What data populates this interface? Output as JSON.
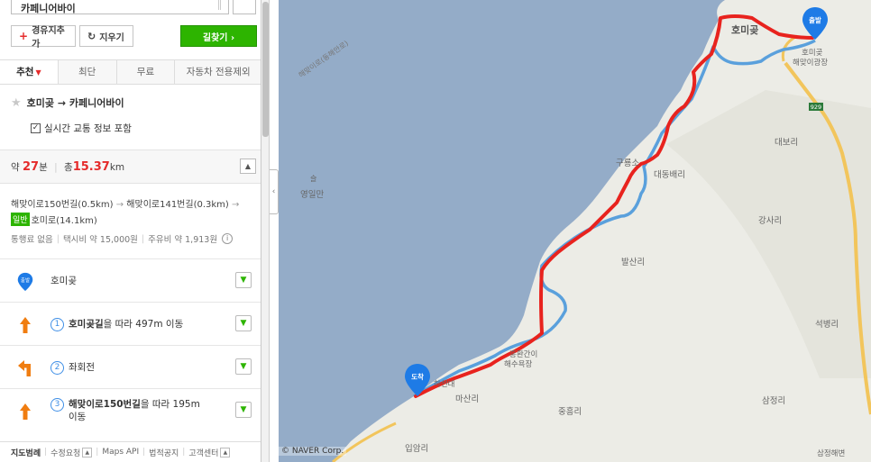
{
  "search": {
    "destination_value": "카페니어바이"
  },
  "buttons": {
    "add_waypoint": "경유지추가",
    "clear": "지우기",
    "find_route": "길찾기 ›"
  },
  "tabs": [
    {
      "label": "추천",
      "active": true
    },
    {
      "label": "최단",
      "active": false
    },
    {
      "label": "무료",
      "active": false
    },
    {
      "label": "자동차 전용제외",
      "active": false
    }
  ],
  "route": {
    "title": "호미곶 → 카페니어바이",
    "traffic_label": "실시간 교통 정보 포함",
    "traffic_checked": true
  },
  "summary": {
    "approx": "약",
    "minutes": "27",
    "minutes_unit": "분",
    "total": "총",
    "distance": "15.37",
    "distance_unit": "km"
  },
  "route_desc": {
    "line1_a": "해맞이로150번길(0.5km)",
    "line1_b": "해맞이로141번길(0.3km)",
    "road_badge": "일반",
    "line2": "호미로(14.1km)",
    "toll": "통행료 없음",
    "taxi": "택시비 약 15,000원",
    "fuel": "주유비 약 1,913원"
  },
  "steps": [
    {
      "type": "start",
      "badge": "출발",
      "text": "호미곶"
    },
    {
      "type": "straight",
      "num": "1",
      "bold": "호미곶길",
      "text": "을 따라 497m 이동"
    },
    {
      "type": "left",
      "num": "2",
      "text": "좌회전"
    },
    {
      "type": "straight",
      "num": "3",
      "bold": "해맞이로150번길",
      "text": "을 따라 195m",
      "text2": "이동"
    }
  ],
  "footer": {
    "items": [
      "지도범례",
      "수정요청",
      "Maps API",
      "법적공지",
      "고객센터"
    ]
  },
  "map": {
    "copyright": "© NAVER Corp.",
    "start_badge": "출발",
    "end_badge": "도착",
    "labels": {
      "homigot": "호미곶",
      "homigot_square": "호미곶",
      "homigot_square2": "해맞이광장",
      "sea": "영일만",
      "sea_top": "슬",
      "daebo": "대보리",
      "daedong": "대동배리",
      "gureum": "구룡소",
      "gangsa": "강사리",
      "balsan": "발산리",
      "seokbyeong": "석병리",
      "jungheung": "중흥리",
      "sanjeong": "삼정리",
      "masan": "마산리",
      "haseon": "하선대",
      "ipam": "입암리",
      "heunghwan": "흥환간이",
      "heunghwan2": "해수욕장",
      "sanjeong_beach": "삼정해변",
      "road_no": "929",
      "shore_road": "해맞이로(동해안로)"
    },
    "colors": {
      "sea": "#94acc8",
      "land": "#ecece6",
      "route": "#e8231e",
      "alt_route": "#5aa0dc",
      "road": "#f2c55c",
      "accent_green": "#2db400",
      "badge_blue": "#1e7be6"
    }
  }
}
